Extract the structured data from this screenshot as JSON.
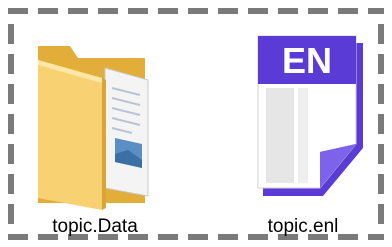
{
  "colors": {
    "dashed_border": "#7a7a7a",
    "folder_front": "#f7cf6a",
    "folder_back": "#e9b640",
    "endnote_brand": "#5b3bd6"
  },
  "selection": {
    "style": "dashed"
  },
  "files": [
    {
      "name": "topic.Data",
      "icon": "folder-icon"
    },
    {
      "name": "topic.enl",
      "icon": "endnote-library-icon",
      "badge": "EN"
    }
  ]
}
